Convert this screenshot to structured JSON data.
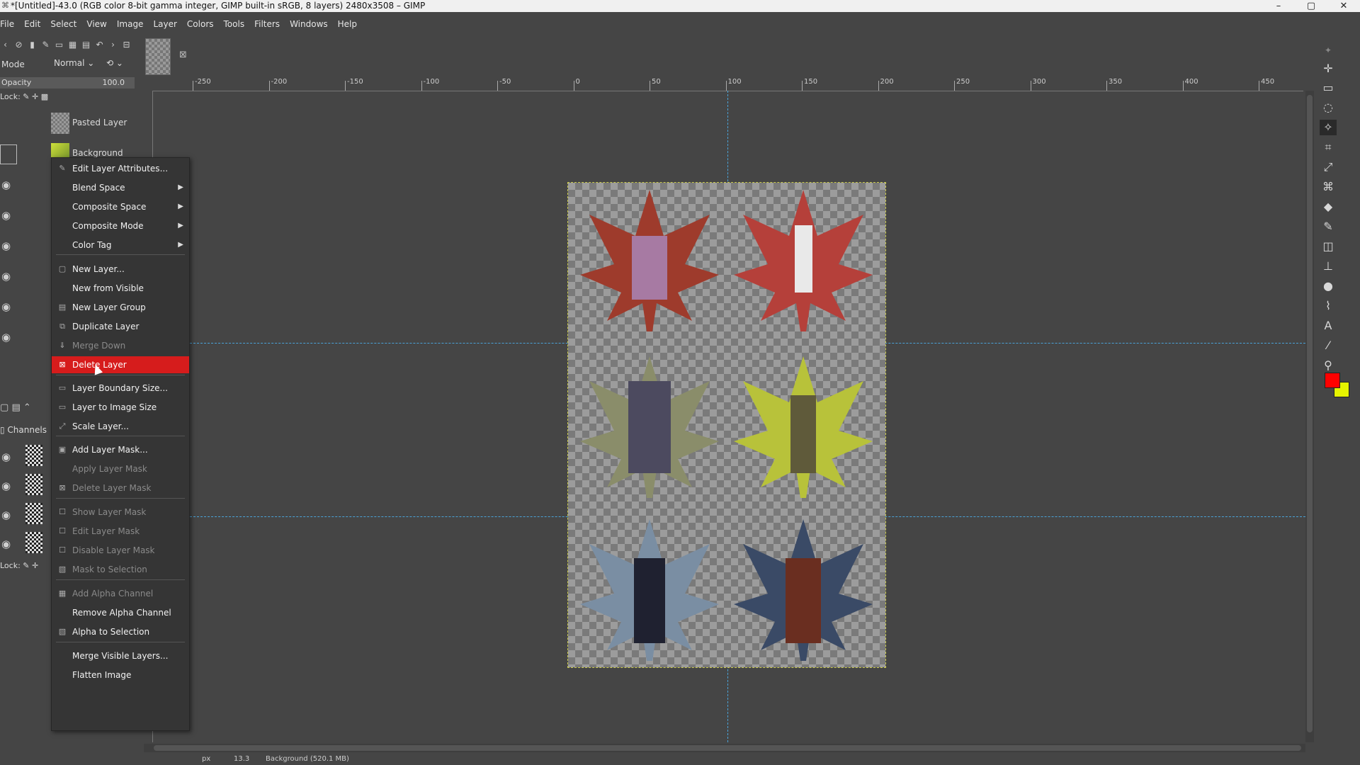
{
  "window": {
    "title": "*[Untitled]-43.0 (RGB color 8-bit gamma integer, GIMP built-in sRGB, 8 layers) 2480x3508 – GIMP",
    "minimize": "–",
    "maximize": "▢",
    "close": "✕"
  },
  "menubar": [
    "File",
    "Edit",
    "Select",
    "View",
    "Image",
    "Layer",
    "Colors",
    "Tools",
    "Filters",
    "Windows",
    "Help"
  ],
  "layers_panel": {
    "mode_label": "Mode",
    "mode_value": "Normal",
    "opacity_label": "Opacity",
    "opacity_value": "100.0",
    "lock_label": "Lock:",
    "layers": [
      {
        "name": "Pasted Layer"
      },
      {
        "name": "Background"
      }
    ],
    "channels_tab": "Channels",
    "lock_label_2": "Lock:"
  },
  "context_menu": {
    "items": [
      {
        "label": "Edit Layer Attributes...",
        "icon": "✎",
        "disabled": false
      },
      {
        "label": "Blend Space",
        "submenu": true
      },
      {
        "label": "Composite Space",
        "submenu": true
      },
      {
        "label": "Composite Mode",
        "submenu": true
      },
      {
        "label": "Color Tag",
        "submenu": true
      },
      {
        "label": "New Layer...",
        "icon": "▢"
      },
      {
        "label": "New from Visible"
      },
      {
        "label": "New Layer Group",
        "icon": "▤"
      },
      {
        "label": "Duplicate Layer",
        "icon": "⧉"
      },
      {
        "label": "Merge Down",
        "icon": "⇓",
        "disabled": true
      },
      {
        "label": "Delete Layer",
        "icon": "⊠",
        "active": true
      },
      {
        "label": "Layer Boundary Size...",
        "icon": "▭"
      },
      {
        "label": "Layer to Image Size",
        "icon": "▭"
      },
      {
        "label": "Scale Layer...",
        "icon": "⤢"
      },
      {
        "label": "Add Layer Mask...",
        "icon": "▣"
      },
      {
        "label": "Apply Layer Mask",
        "disabled": true
      },
      {
        "label": "Delete Layer Mask",
        "icon": "⊠",
        "disabled": true
      },
      {
        "label": "Show Layer Mask",
        "icon": "☐",
        "disabled": true
      },
      {
        "label": "Edit Layer Mask",
        "icon": "☐",
        "disabled": true
      },
      {
        "label": "Disable Layer Mask",
        "icon": "☐",
        "disabled": true
      },
      {
        "label": "Mask to Selection",
        "icon": "▧",
        "disabled": true
      },
      {
        "label": "Add Alpha Channel",
        "icon": "▦",
        "disabled": true
      },
      {
        "label": "Remove Alpha Channel"
      },
      {
        "label": "Alpha to Selection",
        "icon": "▧"
      },
      {
        "label": "Merge Visible Layers..."
      },
      {
        "label": "Flatten Image"
      }
    ]
  },
  "ruler": {
    "labels": [
      "-250",
      "-200",
      "-150",
      "-100",
      "-50",
      "0",
      "50",
      "100",
      "150",
      "200",
      "250",
      "300",
      "350",
      "400",
      "450"
    ]
  },
  "colors": {
    "foreground": "#ff0000",
    "background": "#e6f400",
    "menu_highlight": "#d61c1c"
  },
  "statusbar": {
    "unit": "px",
    "zoom": "13.3",
    "layer_info": "Background (520.1 MB)"
  }
}
